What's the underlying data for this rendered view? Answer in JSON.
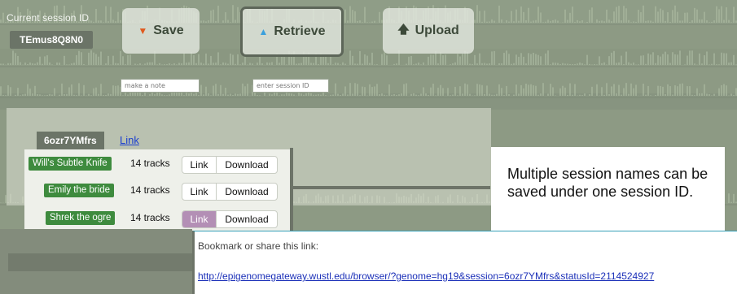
{
  "header": {
    "session_label": "Current session ID",
    "session_id": "TEmus8Q8N0"
  },
  "toolbar": {
    "save_label": "Save",
    "save_icon": "down-triangle-icon",
    "retrieve_label": "Retrieve",
    "retrieve_icon": "up-triangle-icon",
    "upload_label": "Upload",
    "upload_icon": "up-arrow-icon"
  },
  "inputs": {
    "note_placeholder": "make a note",
    "session_placeholder": "enter session ID"
  },
  "sessions": {
    "current_name": "6ozr7YMfrs",
    "current_link": "Link",
    "items": [
      {
        "name": "Will's Subtle Knife",
        "tracks": "14 tracks",
        "link": "Link",
        "download": "Download"
      },
      {
        "name": "Emily the bride",
        "tracks": "14 tracks",
        "link": "Link",
        "download": "Download"
      },
      {
        "name": "Shrek the ogre",
        "tracks": "14 tracks",
        "link": "Link",
        "download": "Download"
      }
    ]
  },
  "callout": {
    "text": "Multiple session names can be saved under one session ID."
  },
  "bookmark": {
    "label": "Bookmark or share this link:",
    "url": "http://epigenomegateway.wustl.edu/browser/?genome=hg19&session=6ozr7YMfrs&statusId=2114524927"
  },
  "colors": {
    "tag_green": "#3e8b3e",
    "link_blue": "#1a3fcf",
    "active_link": "#b38fb5",
    "save_icon": "#e05a1e",
    "retrieve_icon": "#3aa0dc"
  }
}
